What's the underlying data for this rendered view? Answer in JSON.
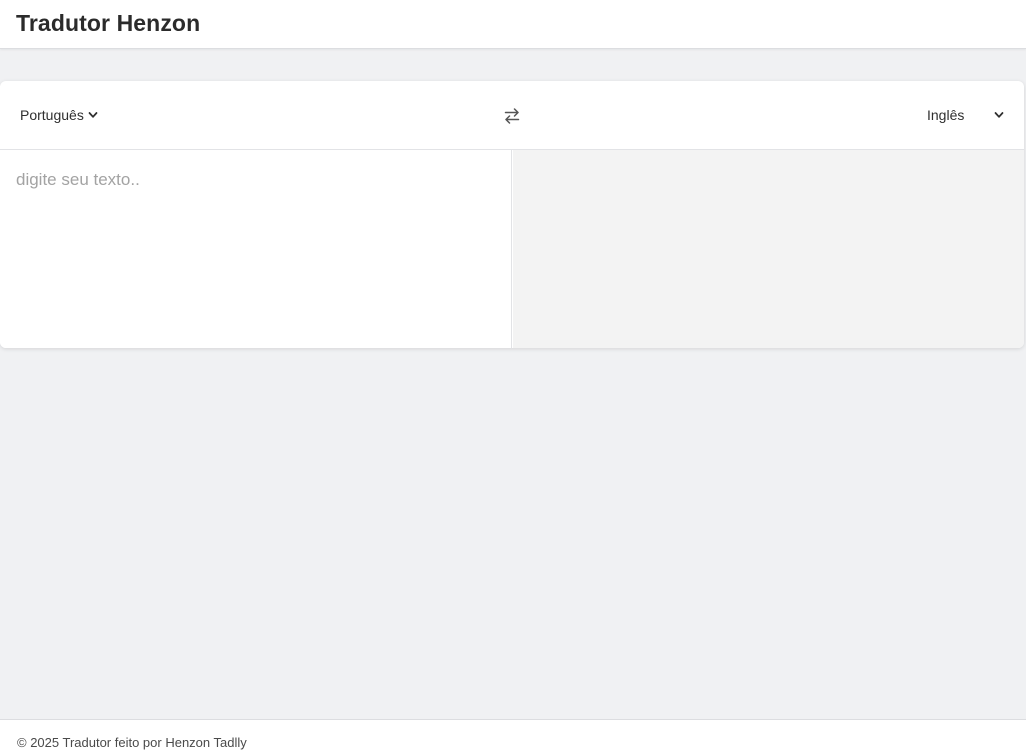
{
  "header": {
    "title": "Tradutor Henzon"
  },
  "translator": {
    "source_language": "Português",
    "target_language": "Inglês",
    "swap_icon": "swap-arrows-icon",
    "source_placeholder": "digite seu texto..",
    "source_value": "",
    "translation": ""
  },
  "footer": {
    "text": "© 2025 Tradutor feito por Henzon Tadlly"
  },
  "colors": {
    "page_background": "#f0f1f3",
    "panel_background": "#ffffff",
    "output_background": "#f3f3f3",
    "title_text": "#2b2b2b",
    "placeholder_text": "#a3a3a3"
  }
}
